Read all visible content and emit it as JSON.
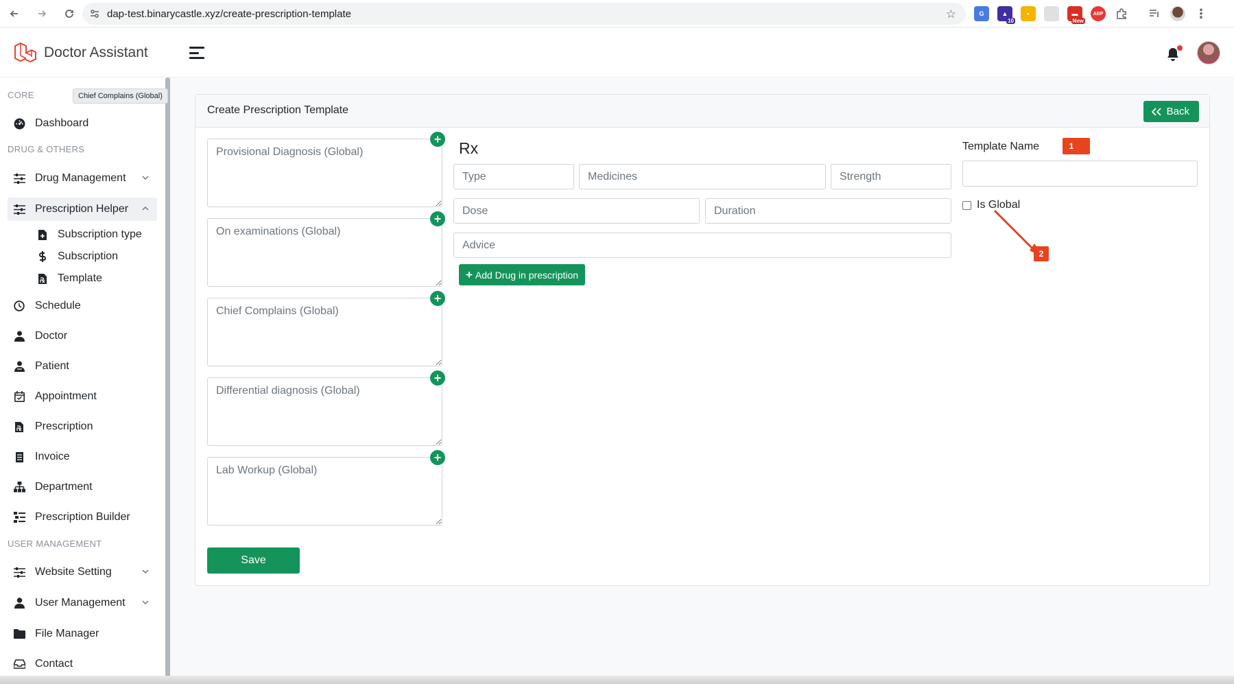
{
  "browser": {
    "url": "dap-test.binarycastle.xyz/create-prescription-template",
    "extension_badges": [
      "10",
      "New",
      "ABP"
    ]
  },
  "app": {
    "brand_name": "Doctor Assistant"
  },
  "sidebar": {
    "tooltip": "Chief Complains (Global)",
    "headings": {
      "core": "CORE",
      "drug_others": "DRUG & OTHERS",
      "user_management": "USER MANAGEMENT"
    },
    "items": {
      "dashboard": "Dashboard",
      "drug_management": "Drug Management",
      "prescription_helper": "Prescription Helper",
      "subscription_type": "Subscription type",
      "subscription": "Subscription",
      "template": "Template",
      "schedule": "Schedule",
      "doctor": "Doctor",
      "patient": "Patient",
      "appointment": "Appointment",
      "prescription": "Prescription",
      "invoice": "Invoice",
      "department": "Department",
      "prescription_builder": "Prescription Builder",
      "website_setting": "Website Setting",
      "user_management": "User Management",
      "file_manager": "File Manager",
      "contact": "Contact"
    }
  },
  "card": {
    "title": "Create Prescription Template",
    "back_label": "Back"
  },
  "form": {
    "textareas": [
      {
        "placeholder": "Provisional Diagnosis (Global)"
      },
      {
        "placeholder": "On examinations (Global)"
      },
      {
        "placeholder": "Chief Complains (Global)"
      },
      {
        "placeholder": "Differential diagnosis (Global)"
      },
      {
        "placeholder": "Lab Workup (Global)"
      }
    ],
    "plus_symbol": "+",
    "rx_label": "Rx",
    "type_placeholder": "Type",
    "medicines_placeholder": "Medicines",
    "strength_placeholder": "Strength",
    "dose_placeholder": "Dose",
    "duration_placeholder": "Duration",
    "advice_placeholder": "Advice",
    "add_drug_label": "Add Drug in prescription",
    "template_name_label": "Template Name",
    "template_name_value": "",
    "is_global_label": "Is Global",
    "is_global_checked": false,
    "save_label": "Save"
  },
  "annotations": [
    "1",
    "2"
  ],
  "colors": {
    "primary_green": "#14945a",
    "annotation_red": "#e8431f",
    "brand_logo_red": "#e74430"
  }
}
